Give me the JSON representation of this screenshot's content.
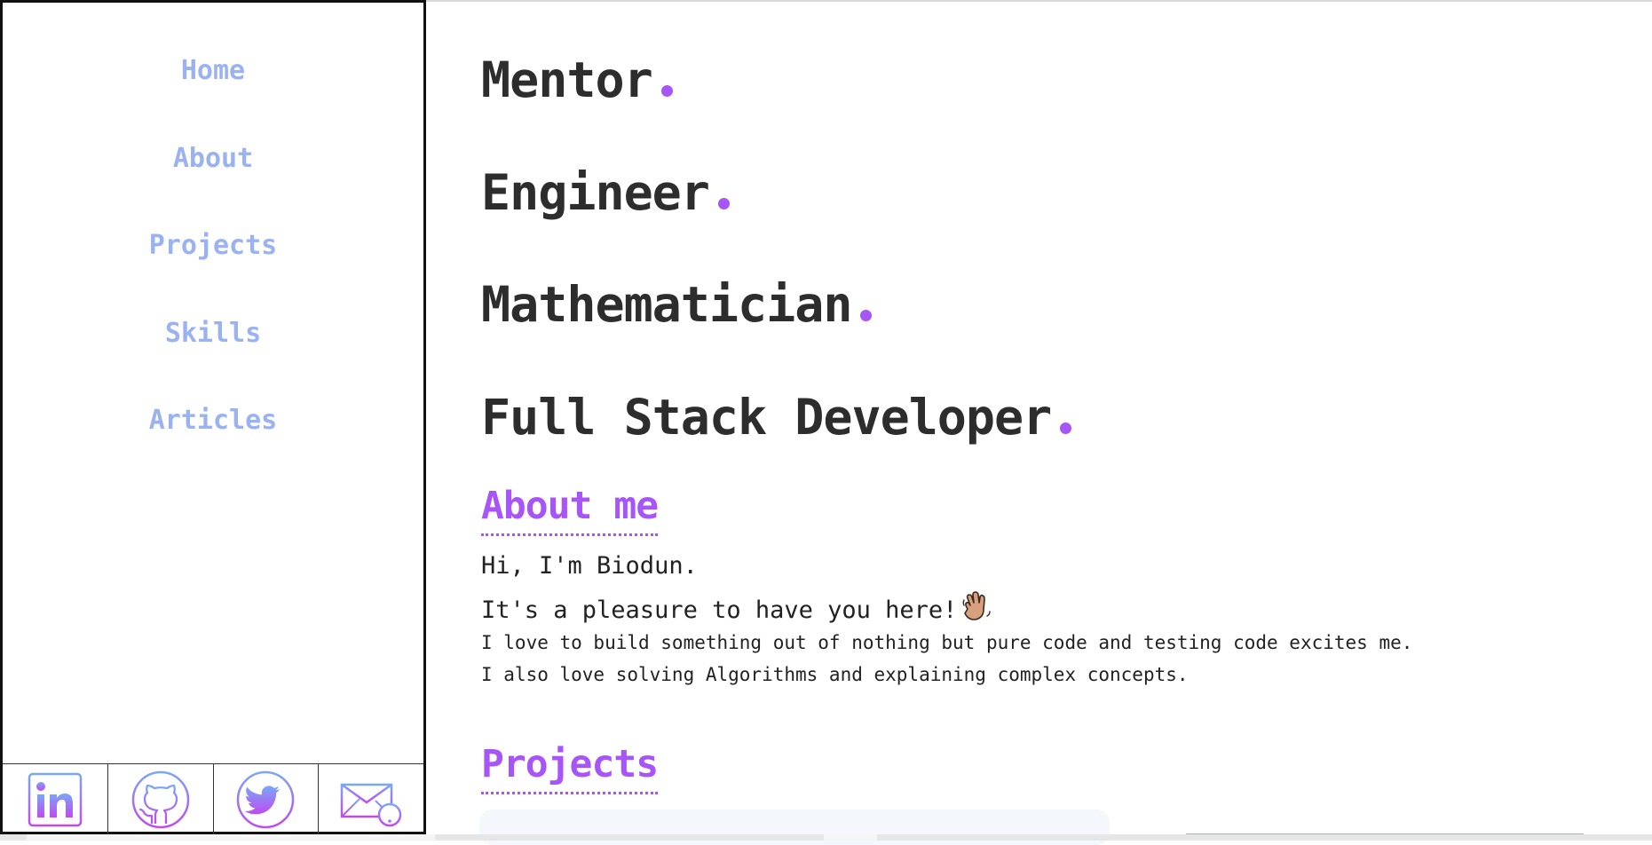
{
  "sidebar": {
    "nav": [
      {
        "label": "Home"
      },
      {
        "label": "About"
      },
      {
        "label": "Projects"
      },
      {
        "label": "Skills"
      },
      {
        "label": "Articles"
      }
    ],
    "socials": [
      {
        "icon": "linkedin-icon"
      },
      {
        "icon": "github-icon"
      },
      {
        "icon": "twitter-icon"
      },
      {
        "icon": "email-icon"
      }
    ]
  },
  "hero": {
    "roles": [
      "Mentor",
      "Engineer",
      "Mathematician",
      "Full Stack Developer"
    ]
  },
  "about": {
    "heading": "About me",
    "greeting": "Hi, I'm Biodun.",
    "welcome": "It's a pleasure to have you here!",
    "paragraph1": "I love to build something out of nothing but pure code and testing code excites me.",
    "paragraph2": "I also love solving Algorithms and explaining complex concepts."
  },
  "projects": {
    "heading": "Projects"
  },
  "colors": {
    "nav_link": "#9ab2f2",
    "accent": "#a855f7",
    "text": "#2d2d2d"
  }
}
